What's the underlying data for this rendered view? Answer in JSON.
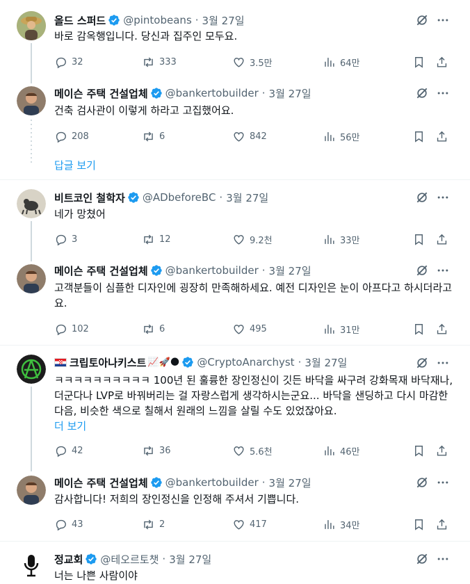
{
  "colors": {
    "accent": "#1d9bf0",
    "muted": "#536471",
    "text": "#0f1419",
    "divider": "#eff3f4"
  },
  "tweets": [
    {
      "name": "올드 스퍼드",
      "handle": "@pintobeans",
      "date": "3월 27일",
      "text": "바로 감옥행입니다. 당신과 집주인 모두요.",
      "replies": "32",
      "retweets": "333",
      "likes": "3.5만",
      "views": "64만"
    },
    {
      "name": "메이슨 주택 건설업체",
      "handle": "@bankertobuilder",
      "date": "3월 27일",
      "text": "건축 검사관이 이렇게 하라고 고집했어요.",
      "replies": "208",
      "retweets": "6",
      "likes": "842",
      "views": "56만"
    },
    {
      "name": "비트코인 철학자",
      "handle": "@ADbeforeBC",
      "date": "3월 27일",
      "text": "네가 망쳤어",
      "replies": "3",
      "retweets": "12",
      "likes": "9.2천",
      "views": "33만"
    },
    {
      "name": "메이슨 주택 건설업체",
      "handle": "@bankertobuilder",
      "date": "3월 27일",
      "text": "고객분들이 심플한 디자인에 굉장히 만족해하세요. 예전 디자인은 눈이 아프다고 하시더라고요.",
      "replies": "102",
      "retweets": "6",
      "likes": "495",
      "views": "31만"
    },
    {
      "name": "크립토아나키스트",
      "handle": "@CryptoAnarchyst",
      "date": "3월 27일",
      "name_emojis": "📈🚀🌑",
      "text": "ㅋㅋㅋㅋㅋㅋㅋㅋㅋㅋ 100년 된 훌륭한 장인정신이 깃든 바닥을 싸구려 강화목재 바닥재나, 더군다나 LVP로 바꿔버리는 걸 자랑스럽게 생각하시는군요... 바닥을 샌딩하고 다시 마감한 다음, 비슷한 색으로 칠해서 원래의 느낌을 살릴 수도 있었잖아요.",
      "more": "더 보기",
      "replies": "42",
      "retweets": "36",
      "likes": "5.6천",
      "views": "46만"
    },
    {
      "name": "메이슨 주택 건설업체",
      "handle": "@bankertobuilder",
      "date": "3월 27일",
      "text": "감사합니다! 저희의 장인정신을 인정해 주셔서 기쁩니다.",
      "replies": "43",
      "retweets": "2",
      "likes": "417",
      "views": "34만"
    },
    {
      "name": "정교회",
      "handle": "@테오르토챗",
      "date": "3월 27일",
      "text": "너는 나쁜 사람이야"
    }
  ],
  "show_replies": "답글 보기",
  "icons": [
    "reply-icon",
    "retweet-icon",
    "like-icon",
    "views-icon",
    "bookmark-icon",
    "share-icon",
    "grok-icon",
    "more-icon",
    "verified-icon"
  ]
}
